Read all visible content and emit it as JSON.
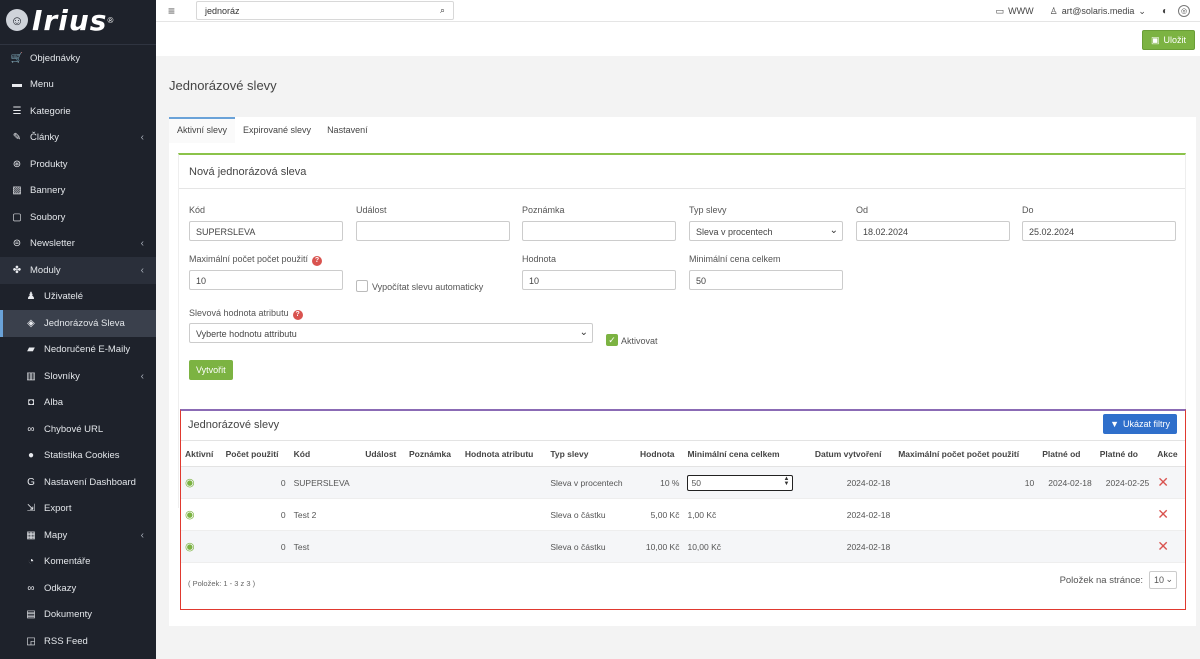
{
  "app": {
    "logo_text": "Irius",
    "logo_reg": "®"
  },
  "sidebar": {
    "items": [
      {
        "label": "Objednávky",
        "icon": "cart-icon"
      },
      {
        "label": "Menu",
        "icon": "folder-icon"
      },
      {
        "label": "Kategorie",
        "icon": "list-icon"
      },
      {
        "label": "Články",
        "icon": "pencil-icon",
        "chevron": "‹"
      },
      {
        "label": "Produkty",
        "icon": "box-icon"
      },
      {
        "label": "Bannery",
        "icon": "image-icon"
      },
      {
        "label": "Soubory",
        "icon": "file-icon"
      },
      {
        "label": "Newsletter",
        "icon": "mail-icon",
        "chevron": "‹"
      },
      {
        "label": "Moduly",
        "icon": "modules-icon",
        "chevron": "‹"
      },
      {
        "label": "Uživatelé",
        "icon": "user-icon"
      },
      {
        "label": "Jednorázová Sleva",
        "icon": "tag-icon"
      },
      {
        "label": "Nedoručené E-Maily",
        "icon": "truck-icon"
      },
      {
        "label": "Slovníky",
        "icon": "books-icon",
        "chevron": "‹"
      },
      {
        "label": "Alba",
        "icon": "camera-icon"
      },
      {
        "label": "Chybové URL",
        "icon": "link-icon"
      },
      {
        "label": "Statistika Cookies",
        "icon": "cookie-icon"
      },
      {
        "label": "Nastavení Dashboard",
        "icon": "google-icon"
      },
      {
        "label": "Export",
        "icon": "export-icon"
      },
      {
        "label": "Mapy",
        "icon": "map-icon",
        "chevron": "‹"
      },
      {
        "label": "Komentáře",
        "icon": "comments-icon"
      },
      {
        "label": "Odkazy",
        "icon": "link-icon"
      },
      {
        "label": "Dokumenty",
        "icon": "document-icon"
      },
      {
        "label": "RSS Feed",
        "icon": "rss-icon"
      }
    ]
  },
  "topbar": {
    "search_value": "jednoráz",
    "www_label": "WWW",
    "user_label": "art@solaris.media"
  },
  "toolbar": {
    "save_label": "Uložit"
  },
  "page": {
    "title": "Jednorázové slevy"
  },
  "tabs": [
    "Aktivní slevy",
    "Expirované slevy",
    "Nastavení"
  ],
  "form": {
    "title": "Nová jednorázová sleva",
    "kod_label": "Kód",
    "kod_value": "SUPERSLEVA",
    "udalost_label": "Událost",
    "udalost_value": "",
    "poznamka_label": "Poznámka",
    "poznamka_value": "",
    "typ_label": "Typ slevy",
    "typ_value": "Sleva v procentech",
    "od_label": "Od",
    "od_value": "18.02.2024",
    "do_label": "Do",
    "do_value": "25.02.2024",
    "max_label": "Maximální počet počet použití",
    "max_value": "10",
    "auto_label": "Vypočítat slevu automaticky",
    "hodnota_label": "Hodnota",
    "hodnota_value": "10",
    "min_label": "Minimální cena celkem",
    "min_value": "50",
    "attr_label": "Slevová hodnota atributu",
    "attr_value": "Vyberte hodnotu attributu",
    "aktivovat_label": "Aktivovat",
    "create_label": "Vytvořit"
  },
  "list": {
    "title": "Jednorázové slevy",
    "filter_label": "Ukázat filtry",
    "columns": [
      "Aktivní",
      "Počet použití",
      "Kód",
      "Událost",
      "Poznámka",
      "Hodnota atributu",
      "Typ slevy",
      "Hodnota",
      "Minimální cena celkem",
      "Datum vytvoření",
      "Maximální počet počet použití",
      "Platné od",
      "Platné do",
      "Akce"
    ],
    "rows": [
      {
        "pocet": "0",
        "kod": "SUPERSLEVA",
        "udalost": "",
        "poznamka": "",
        "atribut": "",
        "typ": "Sleva v procentech",
        "hodnota": "10 %",
        "min_cena": "50",
        "datum": "2024-02-18",
        "max": "10",
        "od": "2024-02-18",
        "do": "2024-02-25"
      },
      {
        "pocet": "0",
        "kod": "Test 2",
        "udalost": "",
        "poznamka": "",
        "atribut": "",
        "typ": "Sleva o částku",
        "hodnota": "5,00 Kč",
        "min_cena": "1,00 Kč",
        "datum": "2024-02-18",
        "max": "",
        "od": "",
        "do": ""
      },
      {
        "pocet": "0",
        "kod": "Test",
        "udalost": "",
        "poznamka": "",
        "atribut": "",
        "typ": "Sleva o částku",
        "hodnota": "10,00 Kč",
        "min_cena": "10,00 Kč",
        "datum": "2024-02-18",
        "max": "",
        "od": "",
        "do": ""
      }
    ],
    "footer": "( Položek: 1 - 3 z 3 )",
    "per_page_label": "Položek na stránce:",
    "per_page_value": "10"
  }
}
